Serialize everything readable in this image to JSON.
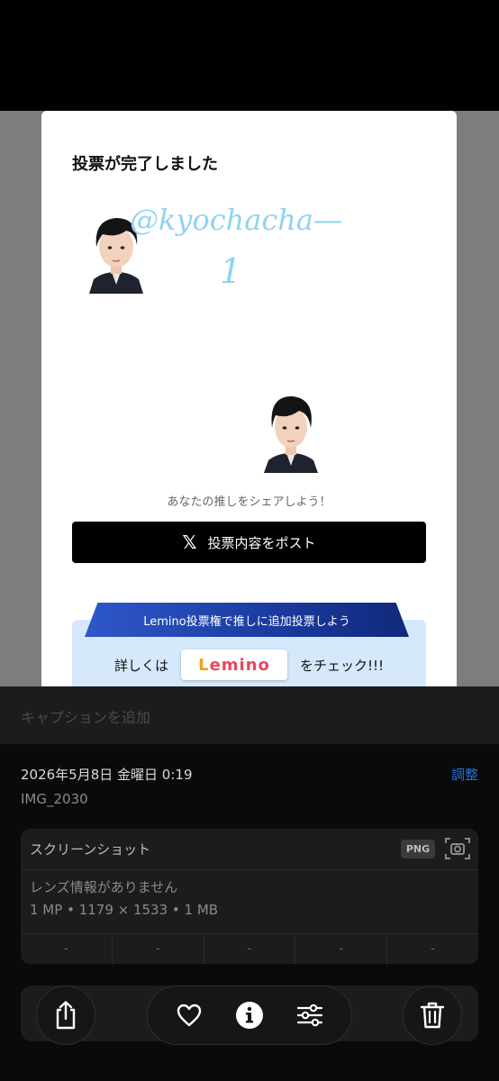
{
  "screenshot": {
    "title": "投票が完了しました",
    "handwriting": {
      "handle": "@kyochacha—",
      "number": "1"
    },
    "share_prompt": "あなたの推しをシェアしよう！",
    "post_button": {
      "icon": "x-logo-icon",
      "label": "投票内容をポスト"
    },
    "lemino": {
      "banner": "Lemino投票権で推しに追加投票しよう",
      "prefix": "詳しくは",
      "logo_text_1": "L",
      "logo_text_2": "emino",
      "suffix": "をチェック!!!"
    }
  },
  "info": {
    "caption_placeholder": "キャプションを追加",
    "date": "2026年5月8日 金曜日 0:19",
    "adjust_label": "調整",
    "file_name": "IMG_2030",
    "meta": {
      "title": "スクリーンショット",
      "format_badge": "PNG",
      "lens": "レンズ情報がありません",
      "specs": "1 MP • 1179 × 1533 • 1 MB",
      "exif": [
        "-",
        "-",
        "-",
        "-",
        "-"
      ]
    }
  },
  "toolbar": {
    "share_icon": "share-icon",
    "favorite_icon": "heart-icon",
    "info_icon": "info-icon",
    "adjust_icon": "sliders-icon",
    "delete_icon": "trash-icon"
  },
  "colors": {
    "accent_link": "#2b6ed8",
    "handwriting": "#8fd3f2",
    "lemino_banner": "#1a3a9e",
    "panel_bg": "#1c1c1e"
  }
}
